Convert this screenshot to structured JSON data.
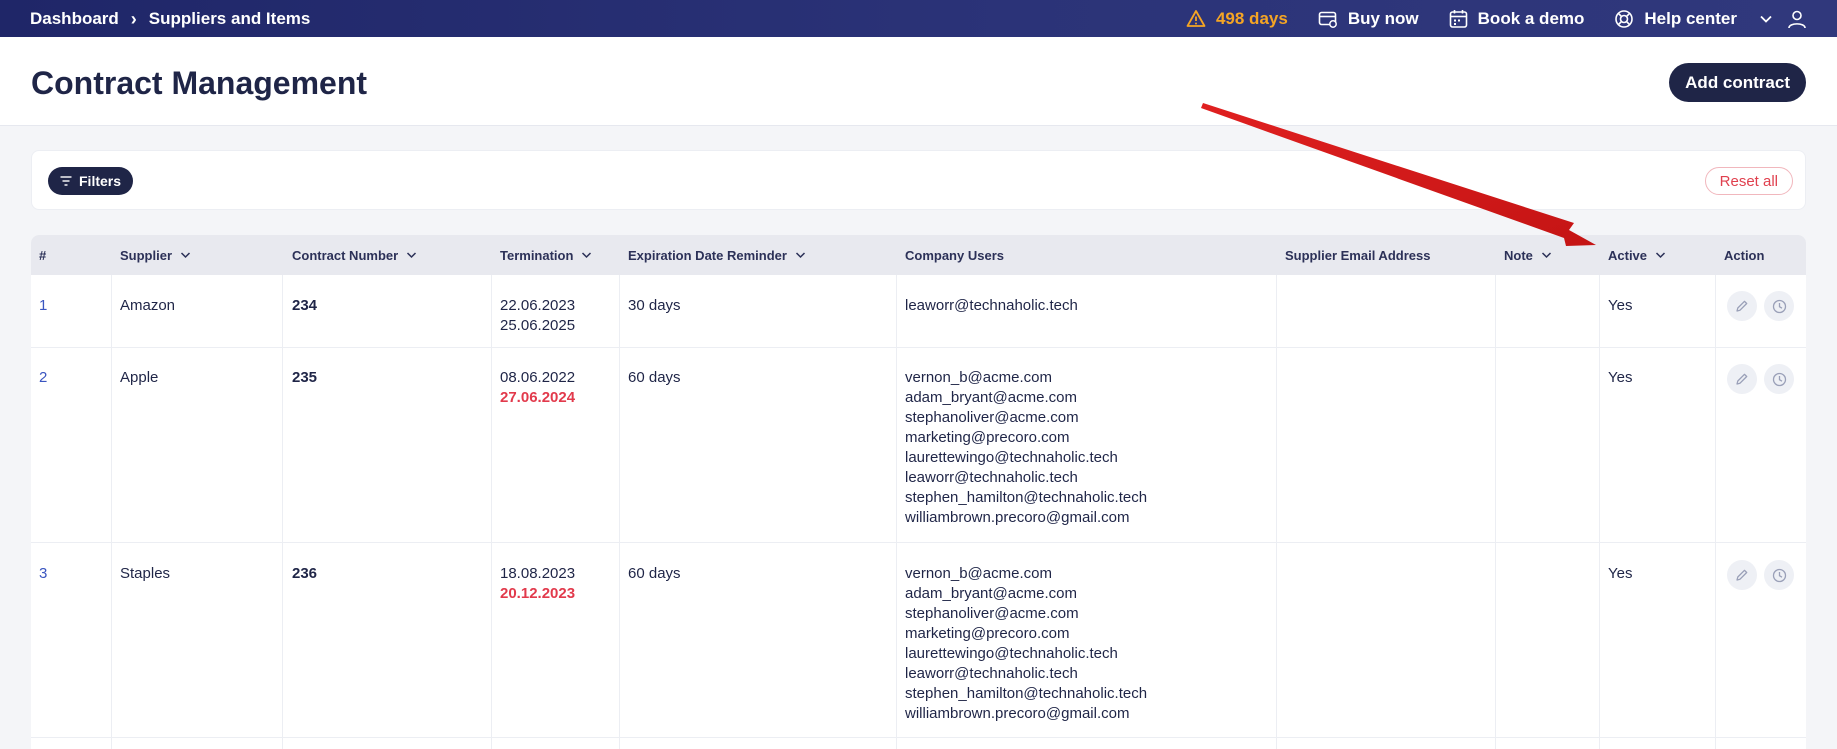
{
  "topbar": {
    "breadcrumb": [
      "Dashboard",
      "Suppliers and Items"
    ],
    "trial_days": "498 days",
    "buy_now": "Buy now",
    "book_demo": "Book a demo",
    "help_center": "Help center"
  },
  "header": {
    "title": "Contract Management",
    "add_contract": "Add contract"
  },
  "filters": {
    "filters_label": "Filters",
    "reset_label": "Reset all"
  },
  "table": {
    "columns": [
      "#",
      "Supplier",
      "Contract Number",
      "Termination",
      "Expiration Date Reminder",
      "Company Users",
      "Supplier Email Address",
      "Note",
      "Active",
      "Action"
    ],
    "rows": [
      {
        "num": "1",
        "supplier": "Amazon",
        "contract": "234",
        "term_start": "22.06.2023",
        "term_end": "25.06.2025",
        "reminder": "30 days",
        "users": [
          "leaworr@technaholic.tech"
        ],
        "supplier_email": "",
        "note": "",
        "active": "Yes"
      },
      {
        "num": "2",
        "supplier": "Apple",
        "contract": "235",
        "term_start": "08.06.2022",
        "term_end": "27.06.2024",
        "reminder": "60 days",
        "users": [
          "vernon_b@acme.com",
          "adam_bryant@acme.com",
          "stephanoliver@acme.com",
          "marketing@precoro.com",
          "laurettewingo@technaholic.tech",
          "leaworr@technaholic.tech",
          "stephen_hamilton@technaholic.tech",
          "williambrown.precoro@gmail.com"
        ],
        "supplier_email": "",
        "note": "",
        "active": "Yes"
      },
      {
        "num": "3",
        "supplier": "Staples",
        "contract": "236",
        "term_start": "18.08.2023",
        "term_end": "20.12.2023",
        "reminder": "60 days",
        "users": [
          "vernon_b@acme.com",
          "adam_bryant@acme.com",
          "stephanoliver@acme.com",
          "marketing@precoro.com",
          "laurettewingo@technaholic.tech",
          "leaworr@technaholic.tech",
          "stephen_hamilton@technaholic.tech",
          "williambrown.precoro@gmail.com"
        ],
        "supplier_email": "",
        "note": "",
        "active": "Yes"
      }
    ]
  },
  "colors": {
    "navy": "#1f2547",
    "warning": "#f5a524",
    "danger": "#e23a4c",
    "annotation_arrow": "#d81c1c"
  }
}
